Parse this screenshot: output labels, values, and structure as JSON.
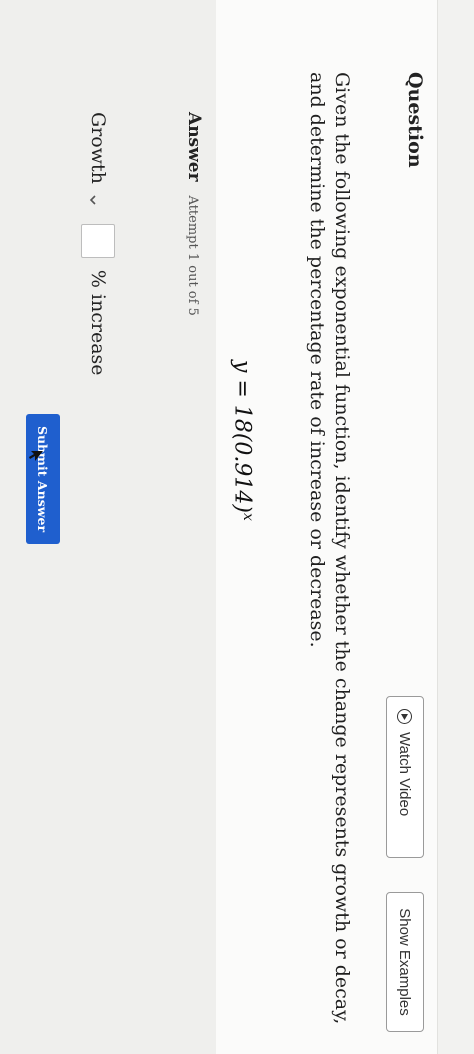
{
  "question": {
    "title": "Question",
    "text": "Given the following exponential function, identify whether the change represents growth or decay, and determine the percentage rate of increase or decrease.",
    "equation": "y = 18(0.914)",
    "equation_exponent": "x"
  },
  "toolbar": {
    "watch_video": "Watch Video",
    "show_examples": "Show Examples"
  },
  "answer": {
    "label": "Answer",
    "attempt": "Attempt 1 out of 5",
    "growth_select_value": "Growth",
    "percent_value": "",
    "increase_label": "% increase",
    "submit_label": "Submit Answer"
  },
  "colors": {
    "submit_button": "#1f5fce",
    "answer_panel": "#efefed"
  },
  "icons": [
    "play-circle-icon",
    "chevron-down-icon",
    "mouse-cursor-icon"
  ]
}
